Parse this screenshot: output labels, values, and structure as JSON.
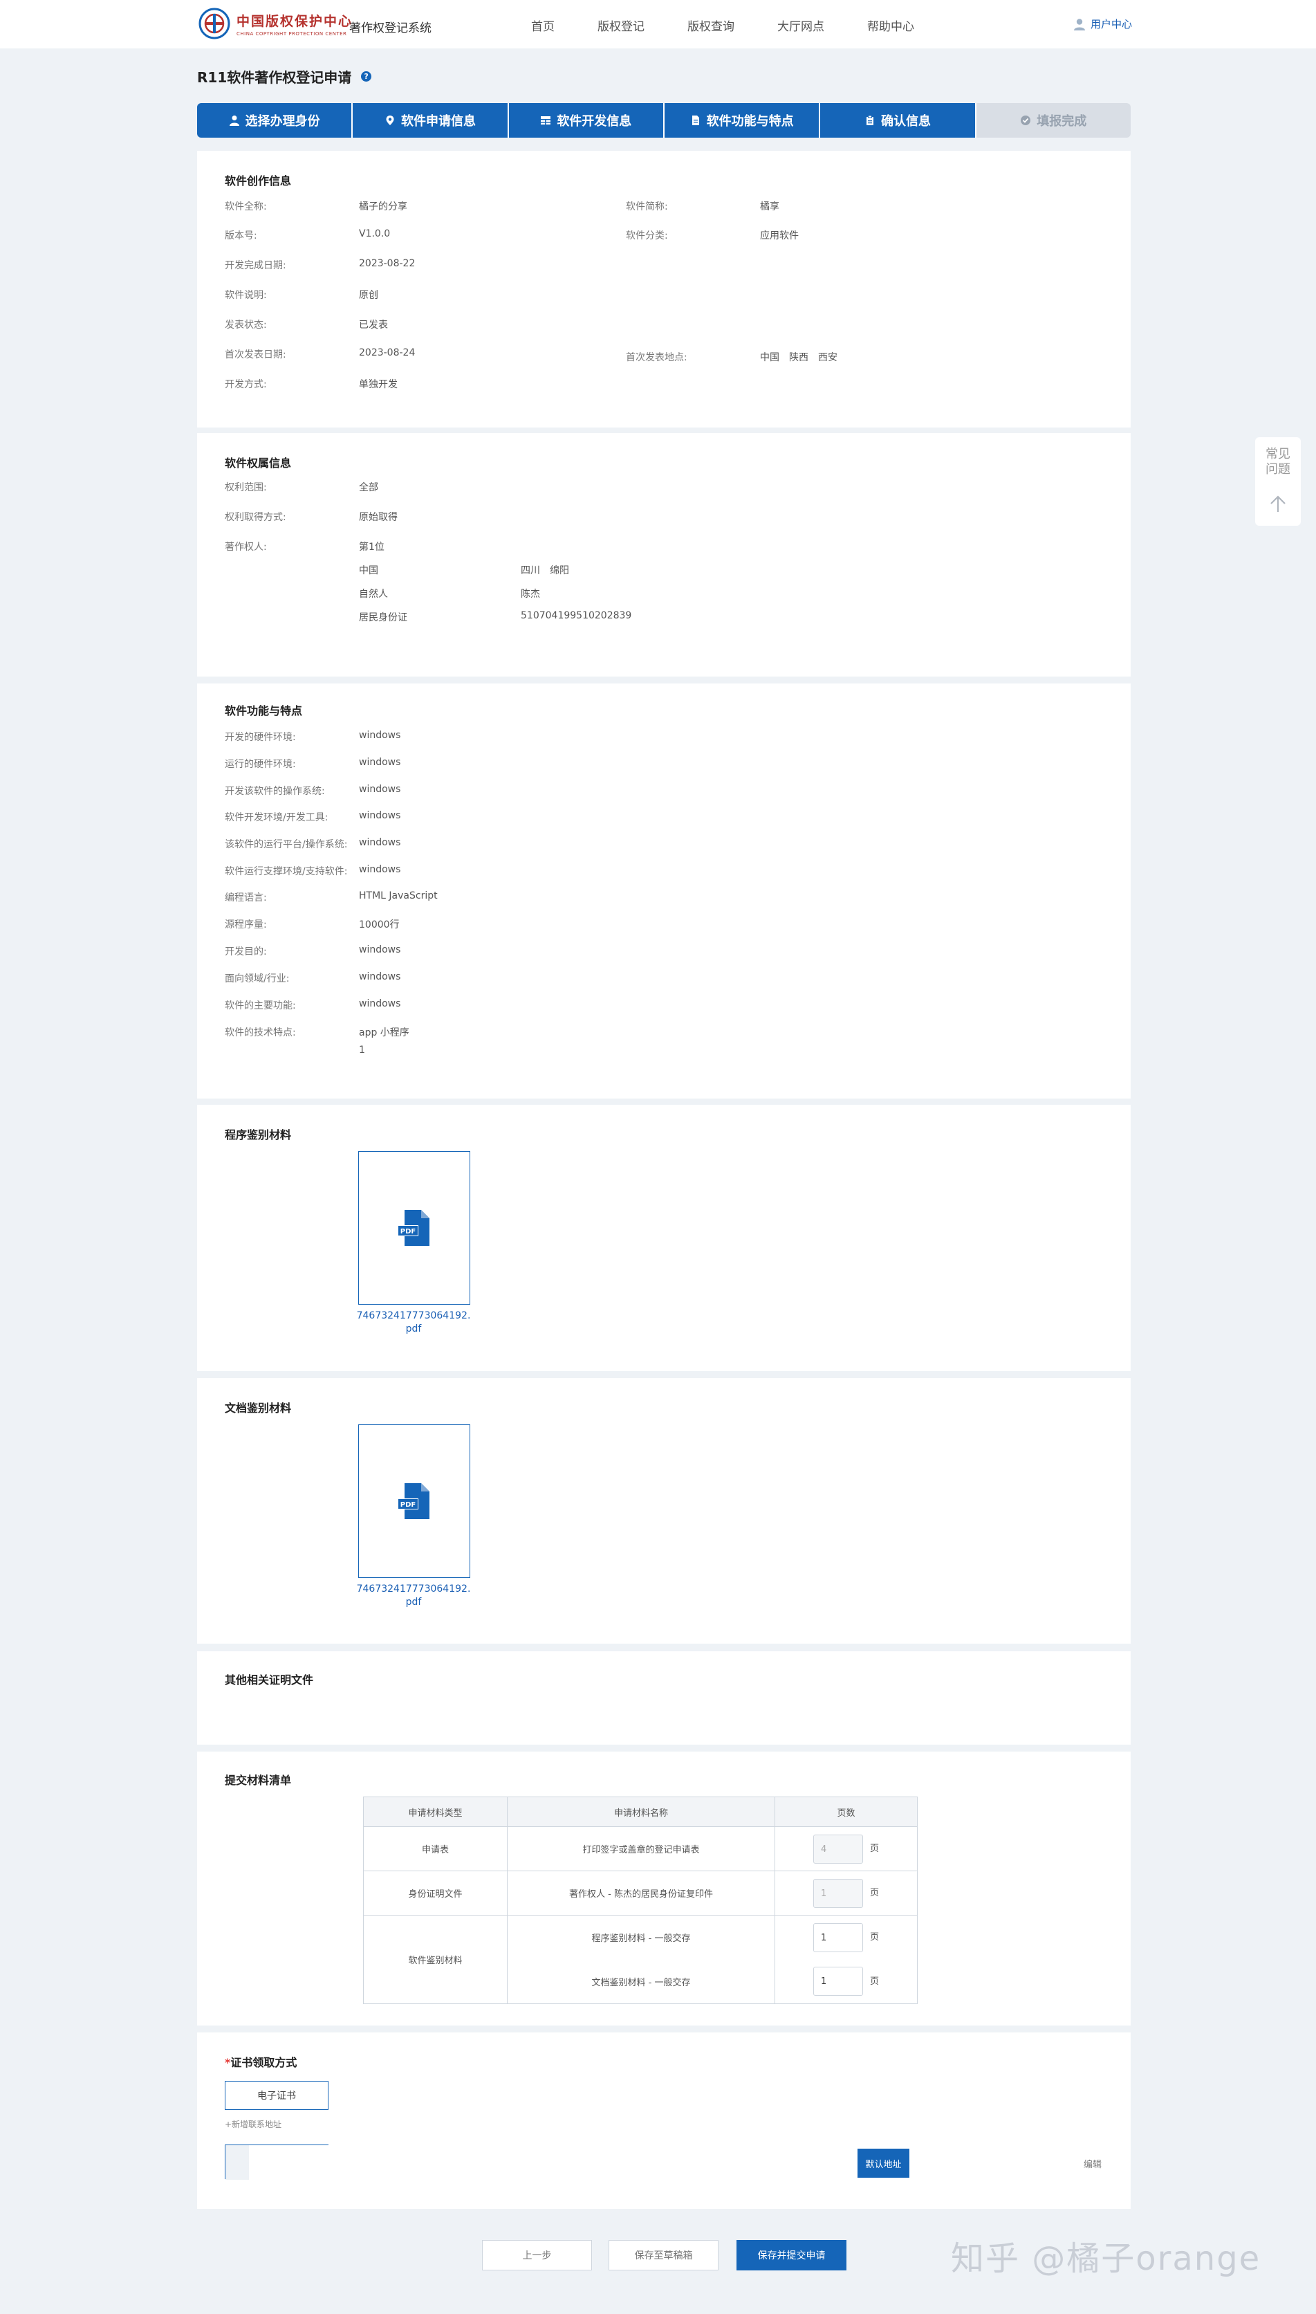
{
  "header": {
    "logo_cn": "中国版权保护中心",
    "logo_en": "CHINA COPYRIGHT PROTECTION CENTER",
    "system_name": "著作权登记系统",
    "nav": [
      "首页",
      "版权登记",
      "版权查询",
      "大厅网点",
      "帮助中心"
    ],
    "user_center": "用户中心"
  },
  "page_title": "R11软件著作权登记申请",
  "help_icon_text": "?",
  "steps": [
    "选择办理身份",
    "软件申请信息",
    "软件开发信息",
    "软件功能与特点",
    "确认信息",
    "填报完成"
  ],
  "creation": {
    "title": "软件创作信息",
    "full_name_label": "软件全称:",
    "full_name": "橘子的分享",
    "short_name_label": "软件简称:",
    "short_name": "橘享",
    "version_label": "版本号:",
    "version": "V1.0.0",
    "category_label": "软件分类:",
    "category": "应用软件",
    "finish_date_label": "开发完成日期:",
    "finish_date": "2023-08-22",
    "desc_label": "软件说明:",
    "desc": "原创",
    "publish_status_label": "发表状态:",
    "publish_status": "已发表",
    "first_publish_date_label": "首次发表日期:",
    "first_publish_date": "2023-08-24",
    "first_publish_place_label": "首次发表地点:",
    "first_publish_place": "中国　陕西　西安",
    "dev_method_label": "开发方式:",
    "dev_method": "单独开发"
  },
  "rights": {
    "title": "软件权属信息",
    "scope_label": "权利范围:",
    "scope": "全部",
    "acquire_label": "权利取得方式:",
    "acquire": "原始取得",
    "owner_label": "著作权人:",
    "owner_index": "第1位",
    "country": "中国",
    "region": "四川　绵阳",
    "person_type": "自然人",
    "person_name": "陈杰",
    "id_type": "居民身份证",
    "id_number": "510704199510202839"
  },
  "features": {
    "title": "软件功能与特点",
    "items": [
      {
        "label": "开发的硬件环境:",
        "value": "windows"
      },
      {
        "label": "运行的硬件环境:",
        "value": "windows"
      },
      {
        "label": "开发该软件的操作系统:",
        "value": "windows"
      },
      {
        "label": "软件开发环境/开发工具:",
        "value": "windows"
      },
      {
        "label": "该软件的运行平台/操作系统:",
        "value": "windows"
      },
      {
        "label": "软件运行支撑环境/支持软件:",
        "value": "windows"
      },
      {
        "label": "编程语言:",
        "value": "HTML  JavaScript"
      },
      {
        "label": "源程序量:",
        "value": "10000行"
      },
      {
        "label": "开发目的:",
        "value": "windows"
      },
      {
        "label": "面向领域/行业:",
        "value": "windows"
      },
      {
        "label": "软件的主要功能:",
        "value": "windows"
      },
      {
        "label": "软件的技术特点:",
        "value": "app  小程序"
      }
    ],
    "extra_value": "1"
  },
  "program_material": {
    "title": "程序鉴别材料",
    "file_name": "746732417773064192.pdf",
    "file_badge": "PDF"
  },
  "document_material": {
    "title": "文档鉴别材料",
    "file_name": "746732417773064192.pdf",
    "file_badge": "PDF"
  },
  "other_docs": {
    "title": "其他相关证明文件"
  },
  "submit_list": {
    "title": "提交材料清单",
    "headers": [
      "申请材料类型",
      "申请材料名称",
      "页数"
    ],
    "unit": "页",
    "rows": [
      {
        "type": "申请表",
        "name": "打印签字或盖章的登记申请表",
        "pages": "4"
      },
      {
        "type": "身份证明文件",
        "name": "著作权人 - 陈杰的居民身份证复印件",
        "pages": "1"
      },
      {
        "type": "软件鉴别材料",
        "name": "程序鉴别材料 - 一般交存",
        "pages": "1"
      },
      {
        "type": "",
        "name": "文档鉴别材料 - 一般交存",
        "pages": "1"
      }
    ]
  },
  "certificate": {
    "required_mark": "*",
    "title": "证书领取方式",
    "option": "电子证书",
    "add_address": "+新增联系地址",
    "default_address": "默认地址",
    "edit": "编辑"
  },
  "side": {
    "faq": "常见问题"
  },
  "buttons": {
    "prev": "上一步",
    "save_draft": "保存至草稿箱",
    "save_submit": "保存并提交申请"
  },
  "watermark": "知乎 @橘子orange",
  "colors": {
    "primary": "#1565b8",
    "brand_red": "#b5322e",
    "background": "#eef2f6"
  }
}
